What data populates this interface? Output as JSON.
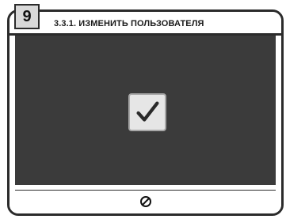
{
  "step": {
    "number": "9"
  },
  "header": {
    "title": "3.3.1. ИЗМЕНИТЬ ПОЛЬЗОВАТЕЛЯ"
  },
  "main": {
    "checkbox_icon": "checkmark-icon",
    "checked": true
  },
  "footer": {
    "icon": "stop-circle-icon"
  },
  "colors": {
    "frame": "#2b2b2b",
    "screen_bg": "#3b3b3b",
    "checkbox_bg": "#e6e6e6"
  }
}
